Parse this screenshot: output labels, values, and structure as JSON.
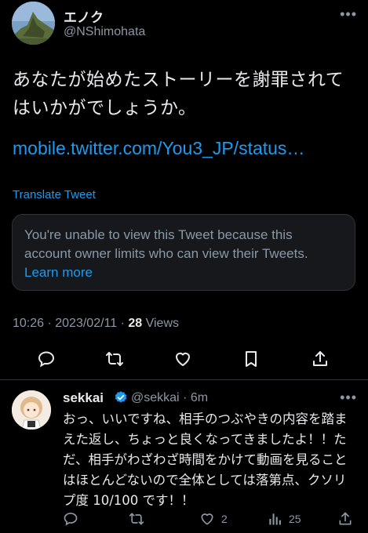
{
  "tweet": {
    "author_name": "エノク",
    "author_handle": "@NShimohata",
    "more": "•••",
    "text": "あなたが始めたストーリーを謝罪されてはいかがでしょうか。",
    "link": "mobile.twitter.com/You3_JP/status…",
    "translate_label": "Translate Tweet",
    "notice_text": "You're unable to view this Tweet because this account owner limits who can view their Tweets. ",
    "notice_link": "Learn more",
    "meta_time": "10:26 · 2023/02/11 · ",
    "views_count": "28",
    "views_label": " Views"
  },
  "reply": {
    "name": "sekkai",
    "handle_time": "@sekkai · 6m",
    "more": "•••",
    "text": "おっ、いいですね、相手のつぶやきの内容を踏まえた返し、ちょっと良くなってきましたよ！！ただ、相手がわざわざ時間をかけて動画を見ることはほとんどないので全体としては落第点、クソリプ度 10/100 です！！",
    "likes": "2",
    "views": "25"
  },
  "icons": {
    "actions_main": [
      "reply-icon",
      "retweet-icon",
      "like-icon",
      "bookmark-icon",
      "share-icon"
    ],
    "actions_reply": [
      "reply-icon",
      "retweet-icon",
      "like-icon",
      "views-icon",
      "share-icon"
    ],
    "verified": "verified-badge-icon"
  },
  "colors": {
    "background": "#000000",
    "text": "#e7e9ea",
    "secondary": "#8b98a5",
    "accent": "#1d9bf0"
  }
}
